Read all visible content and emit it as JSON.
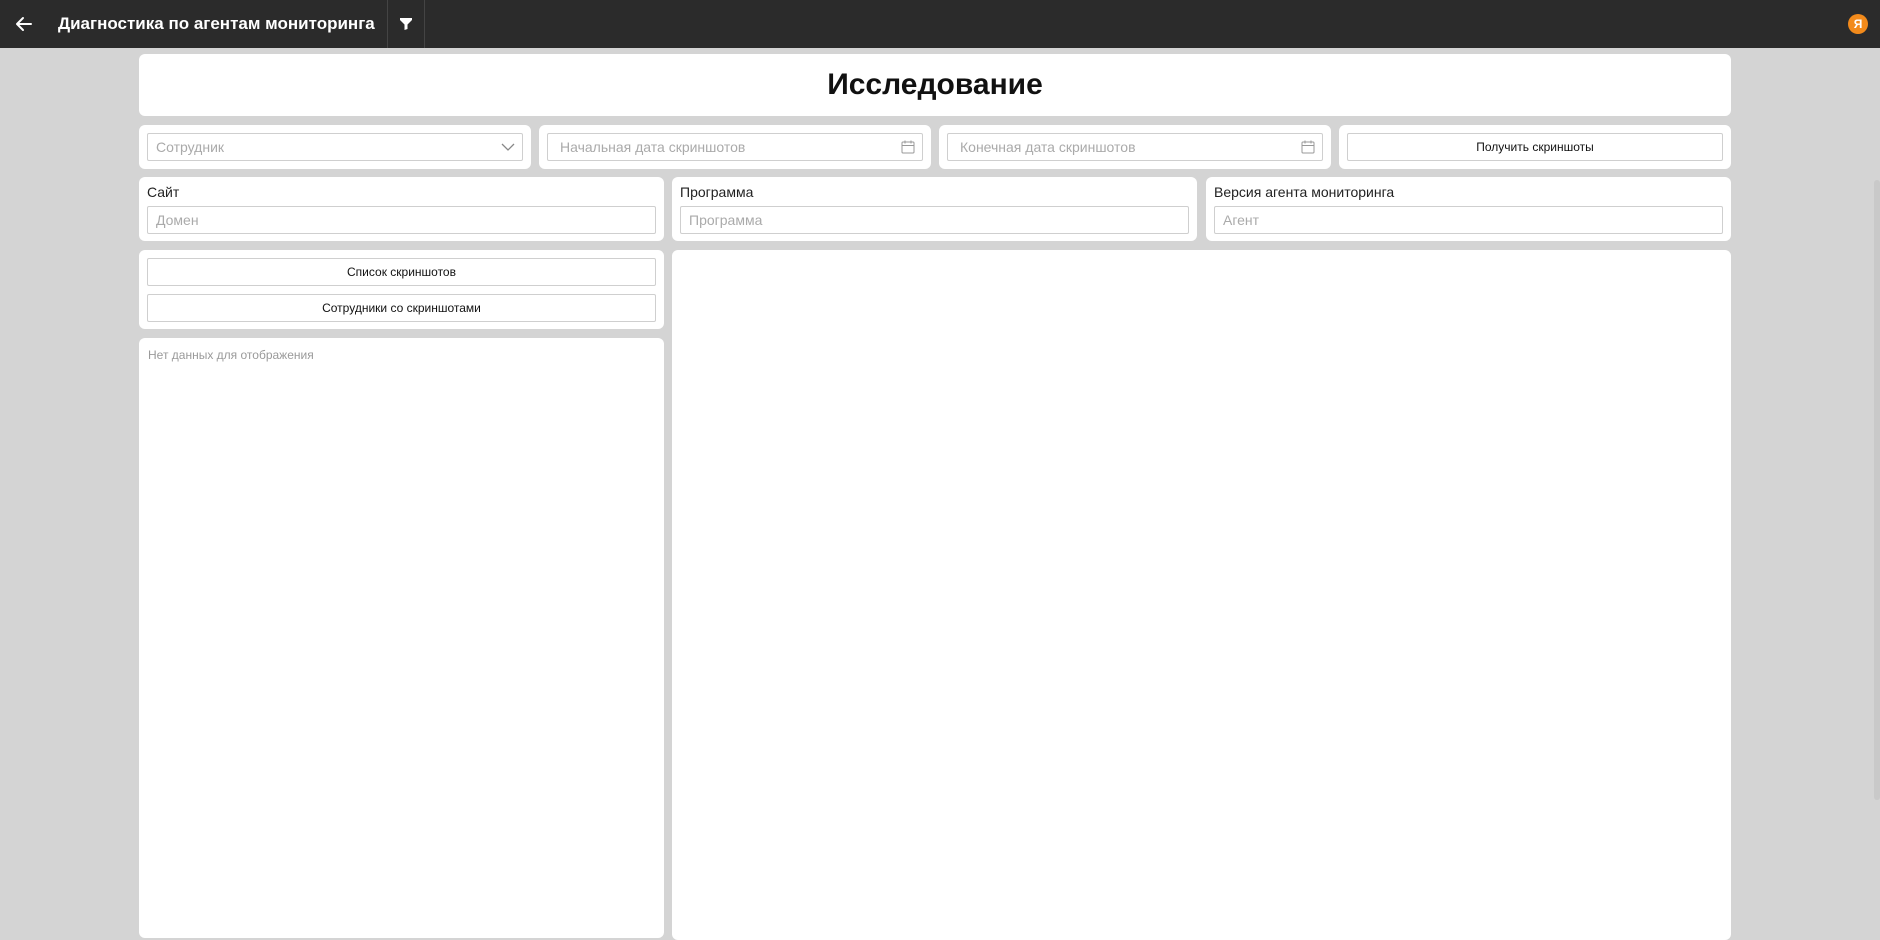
{
  "header": {
    "title": "Диагностика по агентам мониторинга",
    "back_icon": "arrow-left-icon",
    "filter_icon": "filter-icon",
    "avatar_letter": "Я",
    "avatar_color": "#f28a1b"
  },
  "main": {
    "title": "Исследование",
    "employee_select": {
      "placeholder": "Сотрудник"
    },
    "start_date": {
      "placeholder": "Начальная дата скриншотов"
    },
    "end_date": {
      "placeholder": "Конечная дата скриншотов"
    },
    "get_screenshots_label": "Получить скриншоты",
    "site": {
      "label": "Сайт",
      "placeholder": "Домен"
    },
    "program": {
      "label": "Программа",
      "placeholder": "Программа"
    },
    "agent_version": {
      "label": "Версия агента мониторинга",
      "placeholder": "Агент"
    },
    "screenshots_list_label": "Список скриншотов",
    "employees_with_screenshots_label": "Сотрудники со скриншотами",
    "empty_message": "Нет данных для отображения"
  },
  "colors": {
    "topbar": "#2b2b2b",
    "background": "#d4d4d4",
    "accent": "#f28a1b"
  }
}
